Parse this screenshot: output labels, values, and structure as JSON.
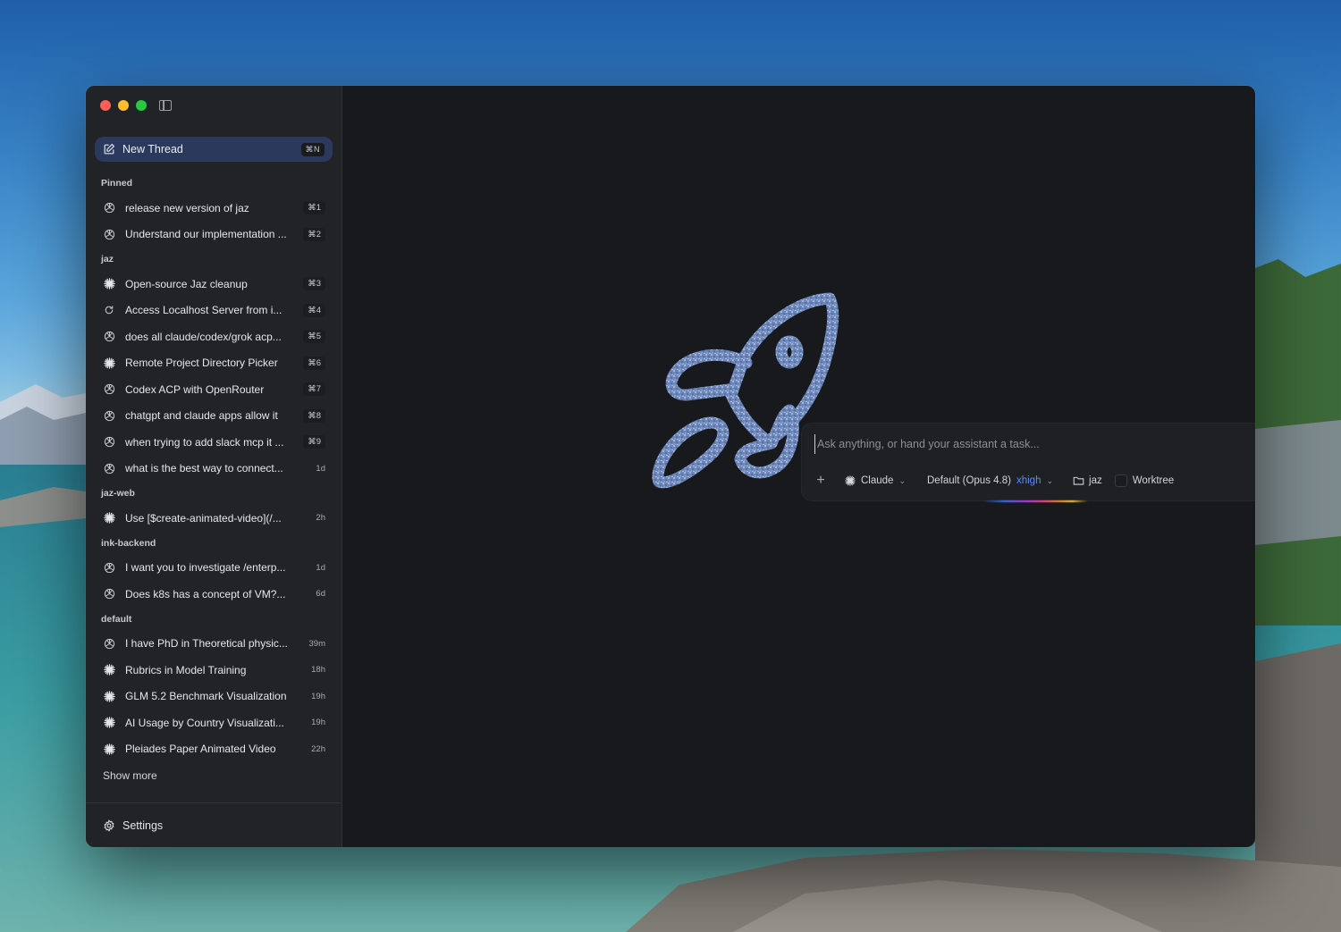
{
  "colors": {
    "accent": "#5b8cff",
    "new_thread_bg": "#2b3a5c",
    "window_bg": "#18191c",
    "sidebar_bg": "#222327"
  },
  "sidebar": {
    "new_thread": {
      "label": "New Thread",
      "shortcut": "⌘N",
      "icon": "compose-icon"
    },
    "sections": [
      {
        "label": "Pinned",
        "items": [
          {
            "icon": "openai-icon",
            "label": "release new version of jaz",
            "meta": "⌘1",
            "kbd": true
          },
          {
            "icon": "openai-icon",
            "label": "Understand our implementation ...",
            "meta": "⌘2",
            "kbd": true
          }
        ]
      },
      {
        "label": "jaz",
        "items": [
          {
            "icon": "claude-icon",
            "label": "Open-source Jaz cleanup",
            "meta": "⌘3",
            "kbd": true
          },
          {
            "icon": "refresh-icon",
            "label": "Access Localhost Server from i...",
            "meta": "⌘4",
            "kbd": true
          },
          {
            "icon": "openai-icon",
            "label": "does all claude/codex/grok acp...",
            "meta": "⌘5",
            "kbd": true
          },
          {
            "icon": "claude-icon",
            "label": "Remote Project Directory Picker",
            "meta": "⌘6",
            "kbd": true
          },
          {
            "icon": "openai-icon",
            "label": "Codex ACP with OpenRouter",
            "meta": "⌘7",
            "kbd": true
          },
          {
            "icon": "openai-icon",
            "label": "chatgpt and claude apps allow it",
            "meta": "⌘8",
            "kbd": true
          },
          {
            "icon": "openai-icon",
            "label": "when trying to add slack mcp it ...",
            "meta": "⌘9",
            "kbd": true
          },
          {
            "icon": "openai-icon",
            "label": "what is the best way to connect...",
            "meta": "1d",
            "kbd": false
          }
        ]
      },
      {
        "label": "jaz-web",
        "items": [
          {
            "icon": "claude-icon",
            "label": "Use [$create-animated-video](/...",
            "meta": "2h",
            "kbd": false
          }
        ]
      },
      {
        "label": "ink-backend",
        "items": [
          {
            "icon": "openai-icon",
            "label": "I want you to investigate /enterp...",
            "meta": "1d",
            "kbd": false
          },
          {
            "icon": "openai-icon",
            "label": "Does k8s has a concept of VM?...",
            "meta": "6d",
            "kbd": false
          }
        ]
      },
      {
        "label": "default",
        "items": [
          {
            "icon": "openai-icon",
            "label": "I have PhD in Theoretical physic...",
            "meta": "39m",
            "kbd": false
          },
          {
            "icon": "claude-icon",
            "label": "Rubrics in Model Training",
            "meta": "18h",
            "kbd": false
          },
          {
            "icon": "claude-icon",
            "label": "GLM 5.2 Benchmark Visualization",
            "meta": "19h",
            "kbd": false
          },
          {
            "icon": "claude-icon",
            "label": "AI Usage by Country Visualizati...",
            "meta": "19h",
            "kbd": false
          },
          {
            "icon": "claude-icon",
            "label": "Pleiades Paper Animated Video",
            "meta": "22h",
            "kbd": false
          }
        ]
      }
    ],
    "show_more": "Show more",
    "settings": {
      "label": "Settings",
      "icon": "gear-icon"
    }
  },
  "composer": {
    "placeholder": "Ask anything, or hand your assistant a task...",
    "value": "",
    "agent": "Claude",
    "model": "Default (Opus 4.8)",
    "effort": "xhigh",
    "folder": "jaz",
    "worktree_label": "Worktree",
    "worktree_checked": false
  }
}
